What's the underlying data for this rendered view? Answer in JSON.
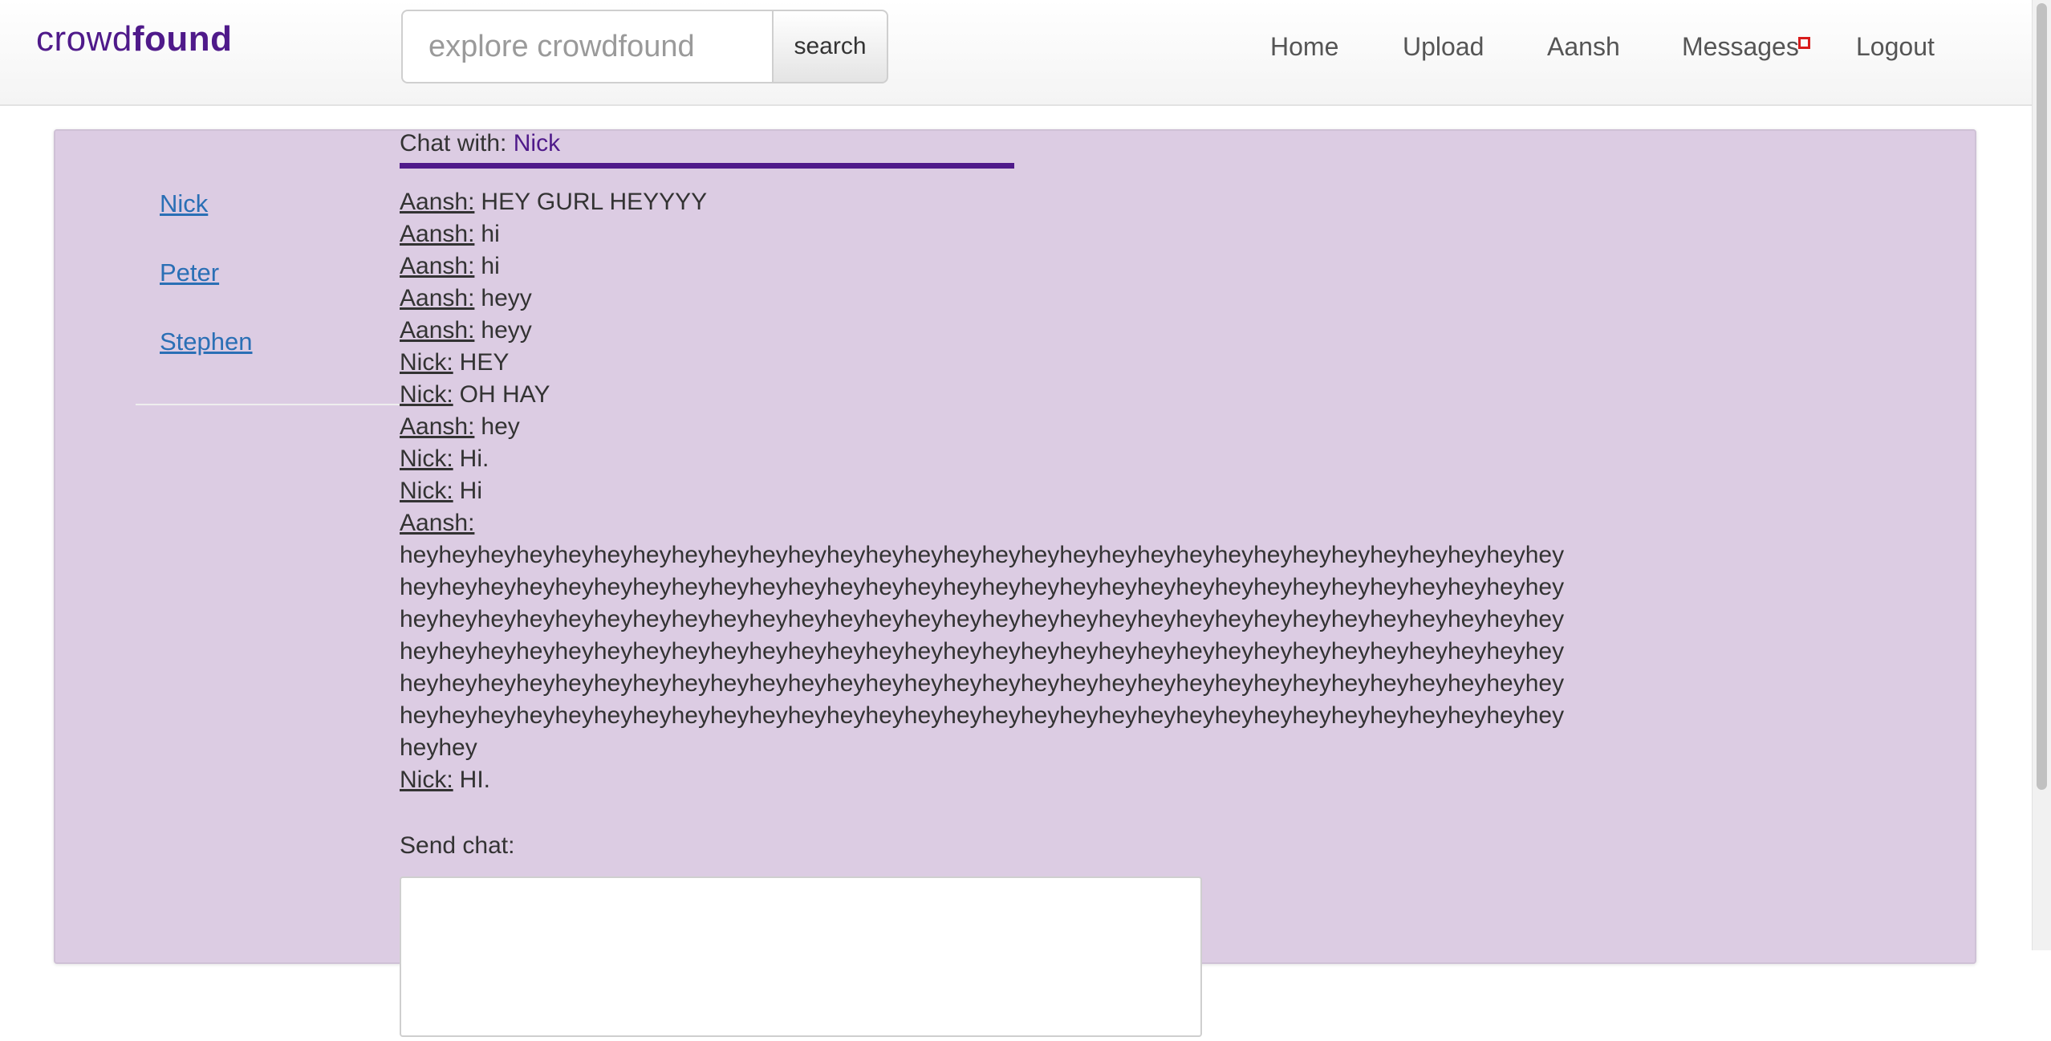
{
  "header": {
    "brand_light": "crowd",
    "brand_bold": "found",
    "search": {
      "placeholder": "explore crowdfound",
      "button_label": "search"
    },
    "nav": {
      "home": "Home",
      "upload": "Upload",
      "user": "Aansh",
      "messages": "Messages",
      "logout": "Logout"
    }
  },
  "sidebar": {
    "contacts": [
      {
        "label": "Nick"
      },
      {
        "label": "Peter"
      },
      {
        "label": "Stephen"
      }
    ]
  },
  "chat": {
    "title_prefix": "Chat with:",
    "partner": "Nick",
    "messages": [
      {
        "sender": "Aansh:",
        "text": "HEY GURL HEYYYY"
      },
      {
        "sender": "Aansh:",
        "text": "hi"
      },
      {
        "sender": "Aansh:",
        "text": "hi"
      },
      {
        "sender": "Aansh:",
        "text": "heyy"
      },
      {
        "sender": "Aansh:",
        "text": "heyy"
      },
      {
        "sender": "Nick:",
        "text": "HEY"
      },
      {
        "sender": "Nick:",
        "text": "OH HAY"
      },
      {
        "sender": "Aansh:",
        "text": "hey"
      },
      {
        "sender": "Nick:",
        "text": "Hi."
      },
      {
        "sender": "Nick:",
        "text": "Hi"
      },
      {
        "sender": "Aansh:",
        "text": "heyheyheyheyheyheyheyheyheyheyheyheyheyheyheyheyheyheyheyheyheyheyheyheyheyheyheyheyheyheyheyheyheyheyheyheyheyheyheyheyheyheyheyheyheyheyheyheyheyheyheyheyheyheyheyheyheyheyheyheyheyheyheyheyheyheyheyheyheyheyheyheyheyheyheyheyheyheyheyheyheyheyheyheyheyheyheyheyheyheyheyheyheyheyheyheyheyheyheyheyheyheyheyheyheyheyheyheyheyheyheyheyheyheyheyheyheyheyheyheyheyheyheyheyheyheyheyheyheyheyheyheyheyheyheyheyheyheyheyheyheyheyheyheyheyheyheyheyheyheyheyheyheyheyheyheyheyheyheyheyheyheyheyheyheyheyheyheyheyheyheyheyheyheyheyheyheyheyheyheyheyhey"
      },
      {
        "sender": "Nick:",
        "text": "HI."
      }
    ],
    "send_label": "Send chat:"
  },
  "colors": {
    "brand": "#4f1a8a",
    "panel_background": "#dccce3",
    "link": "#2a6fb5",
    "notification": "#d81c1c"
  },
  "icons": {
    "messages_indicator": "notification-square-icon"
  }
}
